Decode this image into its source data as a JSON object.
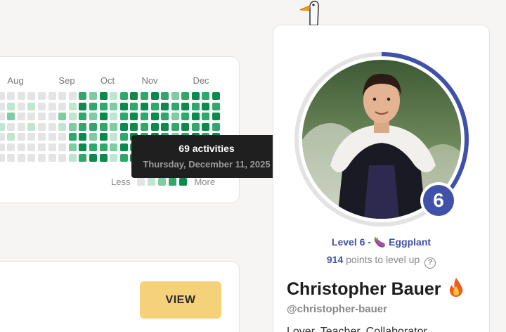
{
  "activity": {
    "months": [
      "Aug",
      "Sep",
      "Oct",
      "Nov",
      "Dec"
    ],
    "legend": {
      "less": "Less",
      "more": "More"
    },
    "tooltip": {
      "count": "69 activities",
      "date": "Thursday, December 11, 2025"
    }
  },
  "card2": {
    "button": "VIEW"
  },
  "profile": {
    "level_badge": "6",
    "level_text": "Level 6 - ",
    "level_emoji": "🍆",
    "level_name": "Eggplant",
    "points_value": "914",
    "points_text": " points to level up",
    "help_icon": "?",
    "name": "Christopher Bauer",
    "handle": "@christopher-bauer",
    "bio_partial": "Lover, Teacher, Collaborator",
    "progress_fraction": 0.4
  },
  "colors": {
    "accent": "#3f51a8",
    "button": "#f5d27a",
    "heat": [
      "#e4e4e4",
      "#bfe6d0",
      "#7fcca2",
      "#2fa86c",
      "#0b8a4c"
    ]
  },
  "icons": [
    "goose-mascot-icon",
    "eggplant-icon",
    "help-circle-icon",
    "fire-icon"
  ]
}
